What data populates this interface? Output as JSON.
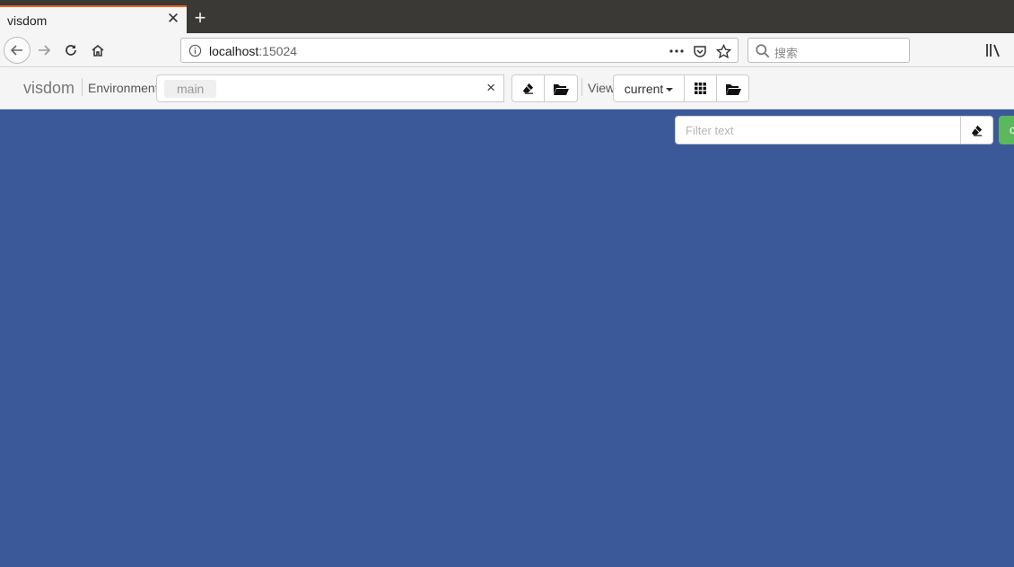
{
  "browser": {
    "tab_title": "visdom",
    "url_host": "localhost",
    "url_port": ":15024",
    "search_placeholder": "搜索"
  },
  "toolbar": {
    "brand": "visdom",
    "environment_label": "Environment",
    "environment_selected": "main",
    "environment_clear": "×",
    "view_label": "View",
    "view_selected": "current"
  },
  "filter": {
    "placeholder": "Filter text",
    "green_button_label": "c"
  },
  "colors": {
    "canvas_bg": "#3b5998",
    "tab_accent": "#e66a2c",
    "green_button": "#5cb85c"
  }
}
